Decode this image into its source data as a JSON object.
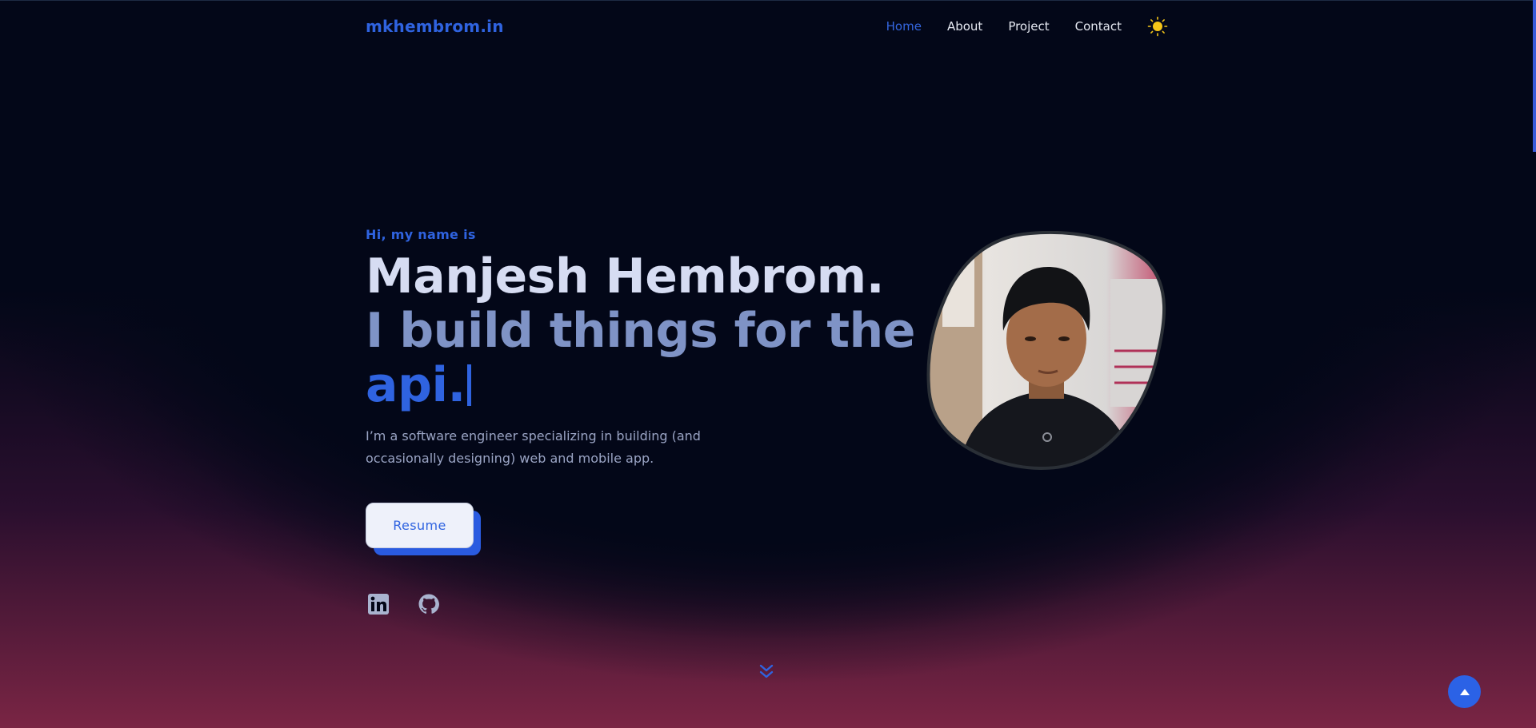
{
  "header": {
    "logo": "mkhembrom.in",
    "nav": [
      {
        "label": "Home",
        "active": true
      },
      {
        "label": "About",
        "active": false
      },
      {
        "label": "Project",
        "active": false
      },
      {
        "label": "Contact",
        "active": false
      }
    ],
    "theme_icon": "sun-icon"
  },
  "hero": {
    "greeting": "Hi, my name is",
    "name": "Manjesh Hembrom.",
    "tagline": "I build things for the",
    "typed_word": "api.",
    "bio": "I’m a software engineer specializing in building (and occasionally designing) web and mobile app.",
    "resume_label": "Resume",
    "socials": [
      {
        "icon": "linkedin-icon"
      },
      {
        "icon": "github-icon"
      }
    ],
    "scroll_icon": "double-chevron-down-icon"
  },
  "scroll_top_icon": "triangle-up-icon",
  "colors": {
    "background": "#030718",
    "accent": "#2f63e0",
    "name_text": "#d6dcf2",
    "tagline_text": "#7f93c6",
    "bio_text": "#9aa4c4",
    "glow_bottom": "#7a2544"
  }
}
